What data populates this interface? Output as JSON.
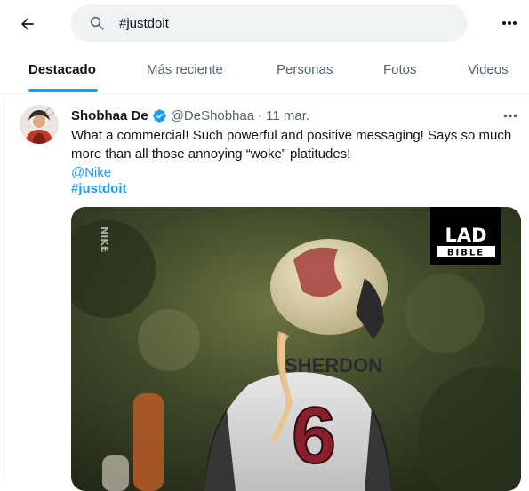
{
  "search": {
    "query": "#justdoit"
  },
  "tabs": [
    {
      "label": "Destacado"
    },
    {
      "label": "Más reciente"
    },
    {
      "label": "Personas"
    },
    {
      "label": "Fotos"
    },
    {
      "label": "Videos"
    }
  ],
  "tweet": {
    "name": "Shobhaa De",
    "handle": "@DeShobhaa",
    "separator": "·",
    "date": "11 mar.",
    "text": "What a commercial! Such powerful and positive messaging! Says so much more than all those annoying “woke” platitudes!",
    "mention": "@Nike",
    "hashtag": "#justdoit",
    "media": {
      "side_text": "NIKE",
      "logo_top": "LAD",
      "logo_bottom": "BIBLE",
      "jersey_name": "SHERDON",
      "jersey_number": "6"
    }
  },
  "colors": {
    "accent": "#1d9bf0",
    "text": "#0f1419",
    "secondary": "#536471",
    "search_bg": "#eff3f4"
  }
}
